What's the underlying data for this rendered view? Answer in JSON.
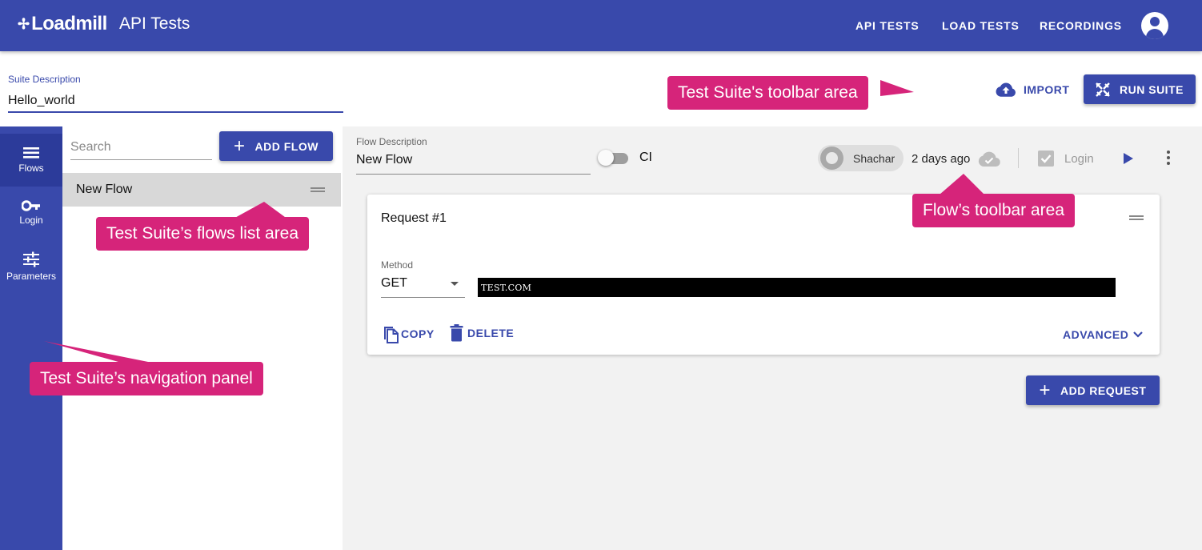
{
  "appbar": {
    "logo_text": "Loadmill",
    "title": "API Tests",
    "nav": [
      "API TESTS",
      "LOAD TESTS",
      "RECORDINGS"
    ]
  },
  "suite": {
    "description_label": "Suite Description",
    "description_value": "Hello_world",
    "import_label": "IMPORT",
    "run_label": "RUN SUITE"
  },
  "nav_rail": {
    "items": [
      {
        "label": "Flows",
        "icon": "list-icon",
        "active": true
      },
      {
        "label": "Login",
        "icon": "key-icon",
        "active": false
      },
      {
        "label": "Parameters",
        "icon": "sliders-icon",
        "active": false
      }
    ]
  },
  "flows_panel": {
    "search_placeholder": "Search",
    "add_flow_label": "ADD FLOW",
    "flows": [
      "New Flow"
    ]
  },
  "flow": {
    "description_label": "Flow Description",
    "description_value": "New Flow",
    "ci_label": "CI",
    "ci_enabled": false,
    "user_name": "Shachar",
    "time_ago": "2 days ago",
    "login_label": "Login",
    "login_checked": true
  },
  "request": {
    "title": "Request #1",
    "method_label": "Method",
    "method_value": "GET",
    "url_value": "TEST.COM",
    "copy_label": "COPY",
    "delete_label": "DELETE",
    "advanced_label": "ADVANCED",
    "add_request_label": "ADD REQUEST"
  },
  "callouts": {
    "toolbar": "Test Suite's toolbar area",
    "flows_list": "Test Suite’s flows list area",
    "navigation": "Test Suite’s navigation panel",
    "flow_toolbar": "Flow’s toolbar area"
  },
  "colors": {
    "primary": "#3949ab",
    "callout": "#d6247a",
    "selected_flow": "#d8d8d8"
  }
}
